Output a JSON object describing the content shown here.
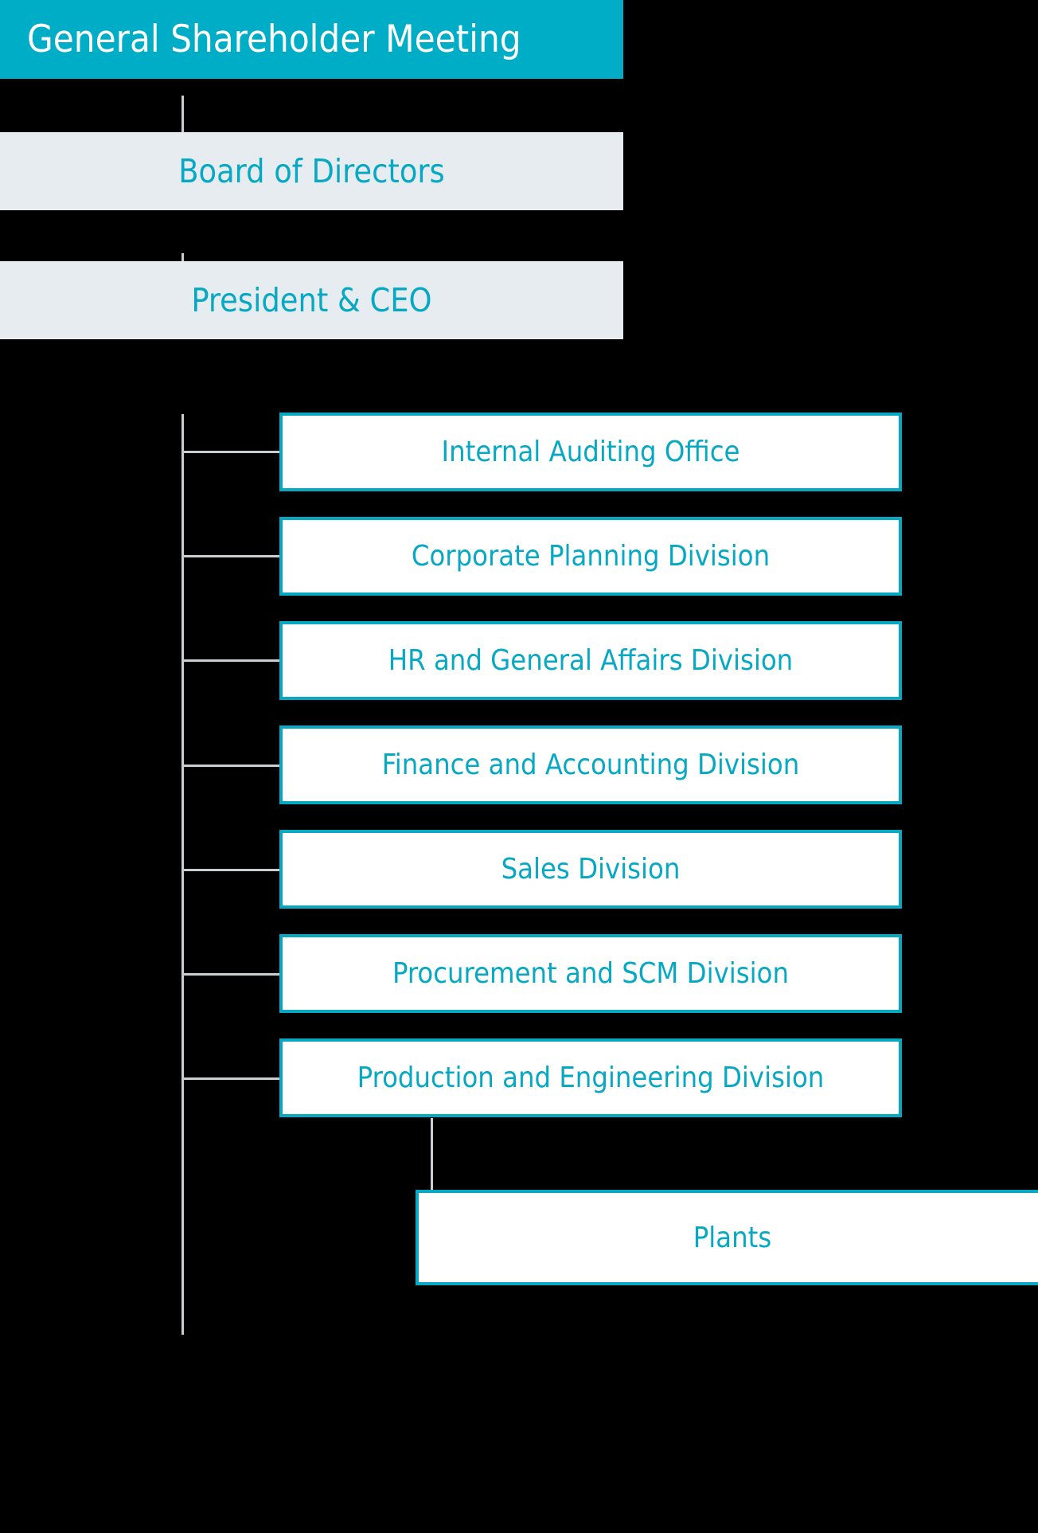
{
  "chart": {
    "type": "organization-chart",
    "background_color": "#000000",
    "accent_color": "#06a8c4",
    "banner_fill": "#00adc6",
    "panel_fill": "#e6ecef",
    "box_fill": "#ffffff",
    "connector_color": "#c9ced1"
  },
  "top_level": {
    "shareholder_meeting": {
      "label": "General Shareholder Meeting",
      "fill": "#00adc6",
      "text_color": "#ffffff"
    },
    "board_of_directors": {
      "label": "Board of Directors",
      "fill": "#e6ecef",
      "text_color": "#06a8c4"
    },
    "president_ceo": {
      "label": "President & CEO",
      "fill": "#e6ecef",
      "text_color": "#06a8c4"
    }
  },
  "divisions": [
    {
      "label": "Internal Auditing Office"
    },
    {
      "label": "Corporate Planning Division"
    },
    {
      "label": "HR and General Affairs Division"
    },
    {
      "label": "Finance and Accounting Division"
    },
    {
      "label": "Sales Division"
    },
    {
      "label": "Procurement and SCM Division"
    },
    {
      "label": "Production and Engineering Division"
    }
  ],
  "sub_units": [
    {
      "label": "Plants",
      "parent": "Production and Engineering Division"
    }
  ]
}
